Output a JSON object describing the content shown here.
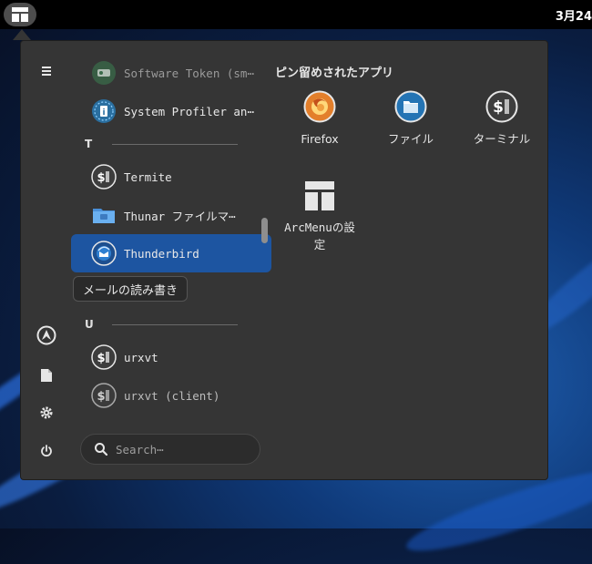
{
  "topbar": {
    "clock": "3月24",
    "arcmenu_icon": "arcmenu-layout-icon"
  },
  "sidebar": {
    "items": [
      {
        "name": "hamburger-menu-icon"
      },
      {
        "name": "arch-logo-icon"
      },
      {
        "name": "document-icon"
      },
      {
        "name": "settings-icon"
      },
      {
        "name": "power-icon"
      }
    ]
  },
  "apps": {
    "list": [
      {
        "label": "Software Token (sm⋯",
        "icon": "software-token-icon",
        "dim": true
      },
      {
        "label": "System Profiler an⋯",
        "icon": "system-profiler-icon"
      },
      {
        "label": "Termite",
        "icon": "terminal-icon"
      },
      {
        "label": "Thunar ファイルマ⋯",
        "icon": "folder-icon"
      },
      {
        "label": "Thunderbird",
        "icon": "thunderbird-icon",
        "selected": true
      },
      {
        "label": "urxvt",
        "icon": "terminal-icon"
      },
      {
        "label": "urxvt (client)",
        "icon": "terminal-icon",
        "dim": true
      }
    ],
    "categories": [
      {
        "letter": "T"
      },
      {
        "letter": "U"
      }
    ],
    "tooltip": "メールの読み書き"
  },
  "search": {
    "placeholder": "Search⋯"
  },
  "pinned": {
    "title": "ピン留めされたアプリ",
    "apps": [
      {
        "label": "Firefox",
        "icon": "firefox-icon"
      },
      {
        "label": "ファイル",
        "icon": "files-icon"
      },
      {
        "label": "ターミナル",
        "icon": "terminal-icon"
      },
      {
        "label": "ArcMenuの設定",
        "icon": "arcmenu-settings-icon"
      }
    ]
  },
  "colors": {
    "menu_bg": "#353535",
    "selection": "#1d55a1",
    "topbar": "#000000"
  }
}
